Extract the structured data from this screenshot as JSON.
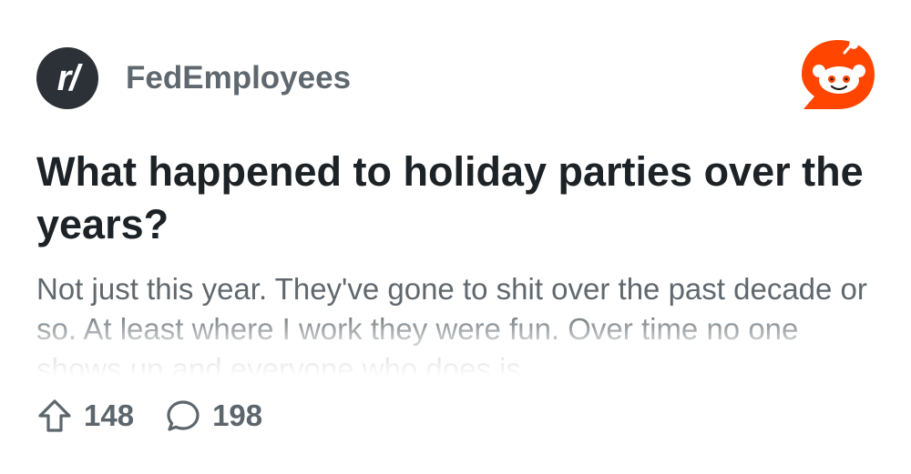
{
  "post": {
    "subreddit_badge": "r/",
    "subreddit_name": "FedEmployees",
    "title": "What happened to holiday parties over the years?",
    "body": "Not just this year. They've gone to shit over the past decade or so. At least where I work they were fun. Over time no one shows up and everyone who does is",
    "upvotes": "148",
    "comments": "198"
  },
  "icons": {
    "brand_logo": "reddit-snoo-icon",
    "upvote": "upvote-arrow-icon",
    "comment": "comment-bubble-icon"
  },
  "colors": {
    "brand": "#ff4500",
    "avatar_bg": "#2b3136",
    "title": "#1c2226",
    "muted": "#60686e"
  }
}
